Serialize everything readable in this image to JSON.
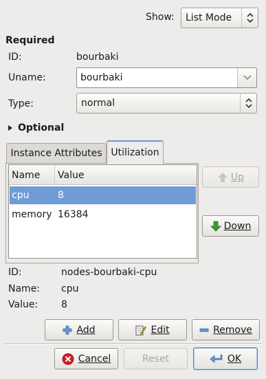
{
  "show": {
    "label": "Show:",
    "value": "List Mode"
  },
  "required": {
    "heading": "Required",
    "id_label": "ID:",
    "id_value": "bourbaki",
    "uname_label": "Uname:",
    "uname_value": "bourbaki",
    "type_label": "Type:",
    "type_value": "normal"
  },
  "optional": {
    "heading": "Optional"
  },
  "tabs": [
    {
      "label": "Instance Attributes",
      "active": false
    },
    {
      "label": "Utilization",
      "active": true
    }
  ],
  "table": {
    "columns": [
      "Name",
      "Value"
    ],
    "rows": [
      {
        "name": "cpu",
        "value": "8",
        "selected": true
      },
      {
        "name": "memory",
        "value": "16384",
        "selected": false
      }
    ]
  },
  "side_buttons": {
    "up": "Up",
    "down": "Down"
  },
  "detail": {
    "id_label": "ID:",
    "id_value": "nodes-bourbaki-cpu",
    "name_label": "Name:",
    "name_value": "cpu",
    "value_label": "Value:",
    "value_value": "8"
  },
  "actions": {
    "add": "Add",
    "edit": "Edit",
    "remove": "Remove"
  },
  "dialog": {
    "cancel": "Cancel",
    "reset": "Reset",
    "ok": "OK"
  },
  "colors": {
    "selection": "#6f9bd6",
    "accent_green": "#3e9a2f",
    "accent_red": "#cc2222"
  }
}
